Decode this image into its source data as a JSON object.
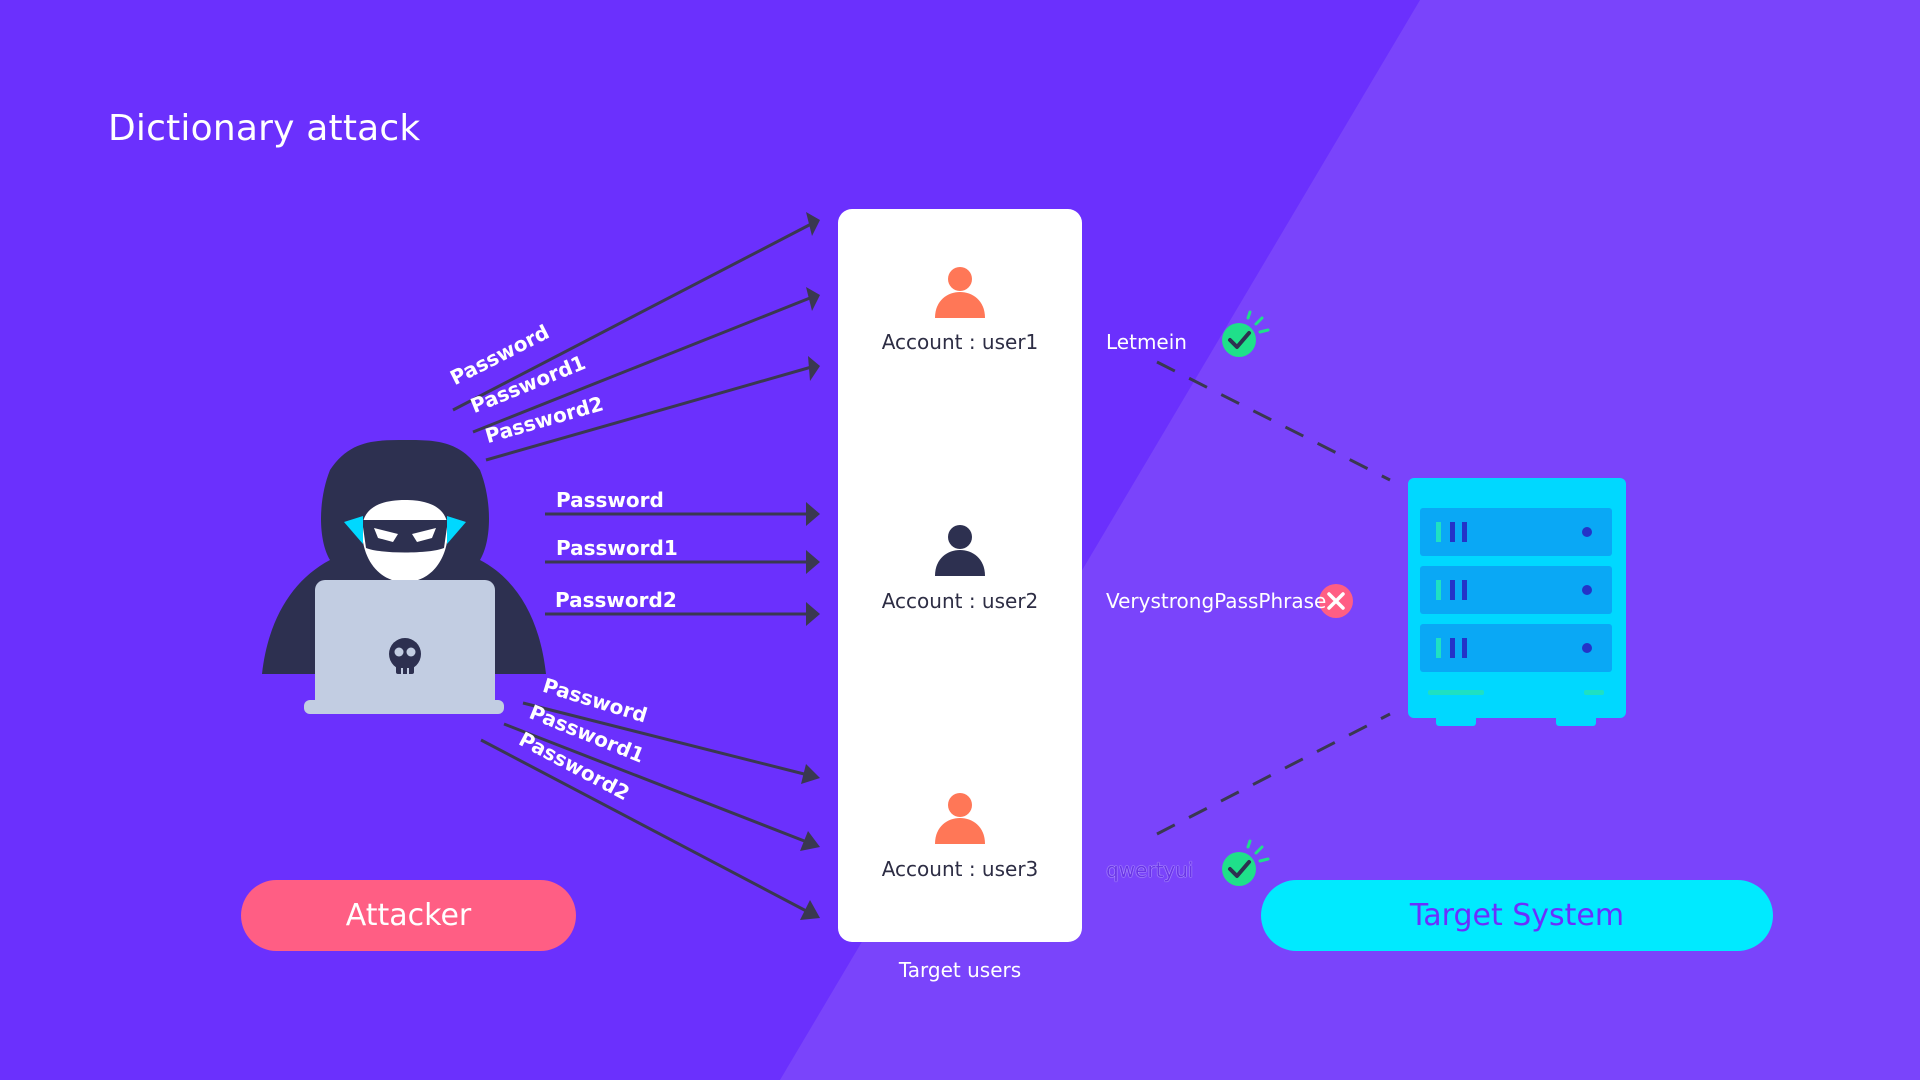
{
  "title": "Dictionary attack",
  "attacker_label": "Attacker",
  "target_system_label": "Target System",
  "target_users_label": "Target users",
  "accounts": [
    {
      "label": "Account : user1",
      "password": "Letmein",
      "result": "success"
    },
    {
      "label": "Account : user2",
      "password": "VerystrongPassPhrase",
      "result": "failure"
    },
    {
      "label": "Account : user3",
      "password": "qwertyui",
      "result": "success"
    }
  ],
  "attempts": [
    "Password",
    "Password1",
    "Password2"
  ],
  "colors": {
    "background": "#6b30fd",
    "background_right": "#7a44fb",
    "attacker_pill": "#ff5e84",
    "target_pill": "#00eaff",
    "success": "#1fe08a",
    "failure": "#ff5e84",
    "user_orange": "#ff7757",
    "user_dark": "#2d3050",
    "server": "#00d8ff"
  }
}
